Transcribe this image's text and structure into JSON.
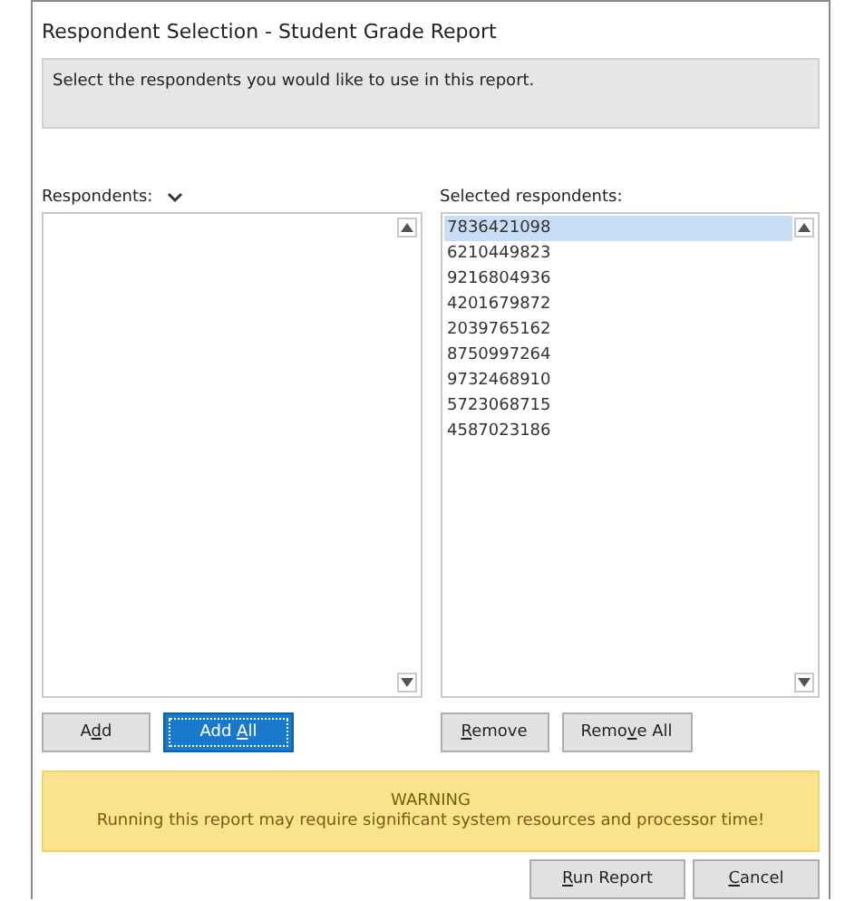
{
  "window": {
    "title": "Respondent Selection - Student Grade Report"
  },
  "instructions": "Select the respondents you would like to use in this report.",
  "available": {
    "label": "Respondents:"
  },
  "selected": {
    "label": "Selected respondents:",
    "items": [
      {
        "text": "7836421098",
        "selected": true
      },
      {
        "text": "6210449823",
        "selected": false
      },
      {
        "text": "9216804936",
        "selected": false
      },
      {
        "text": "4201679872",
        "selected": false
      },
      {
        "text": "2039765162",
        "selected": false
      },
      {
        "text": "8750997264",
        "selected": false
      },
      {
        "text": "9732468910",
        "selected": false
      },
      {
        "text": "5723068715",
        "selected": false
      },
      {
        "text": "4587023186",
        "selected": false
      }
    ]
  },
  "left_buttons": [
    {
      "before": "A",
      "access_key": "d",
      "after": "d",
      "focused": false
    },
    {
      "before": "Add ",
      "access_key": "A",
      "after": "ll",
      "focused": true
    }
  ],
  "right_buttons": [
    {
      "access_key": "R",
      "after": "emove",
      "focused": false
    },
    {
      "before": "Remo",
      "access_key": "v",
      "after": "e All",
      "focused": false
    }
  ],
  "warning": {
    "title": "WARNING",
    "message": "Running this report may require significant system resources and processor time!"
  },
  "footer_buttons": [
    {
      "access_key": "R",
      "after": "un Report",
      "focused": false
    },
    {
      "access_key": "C",
      "after": "ancel",
      "focused": false
    }
  ]
}
